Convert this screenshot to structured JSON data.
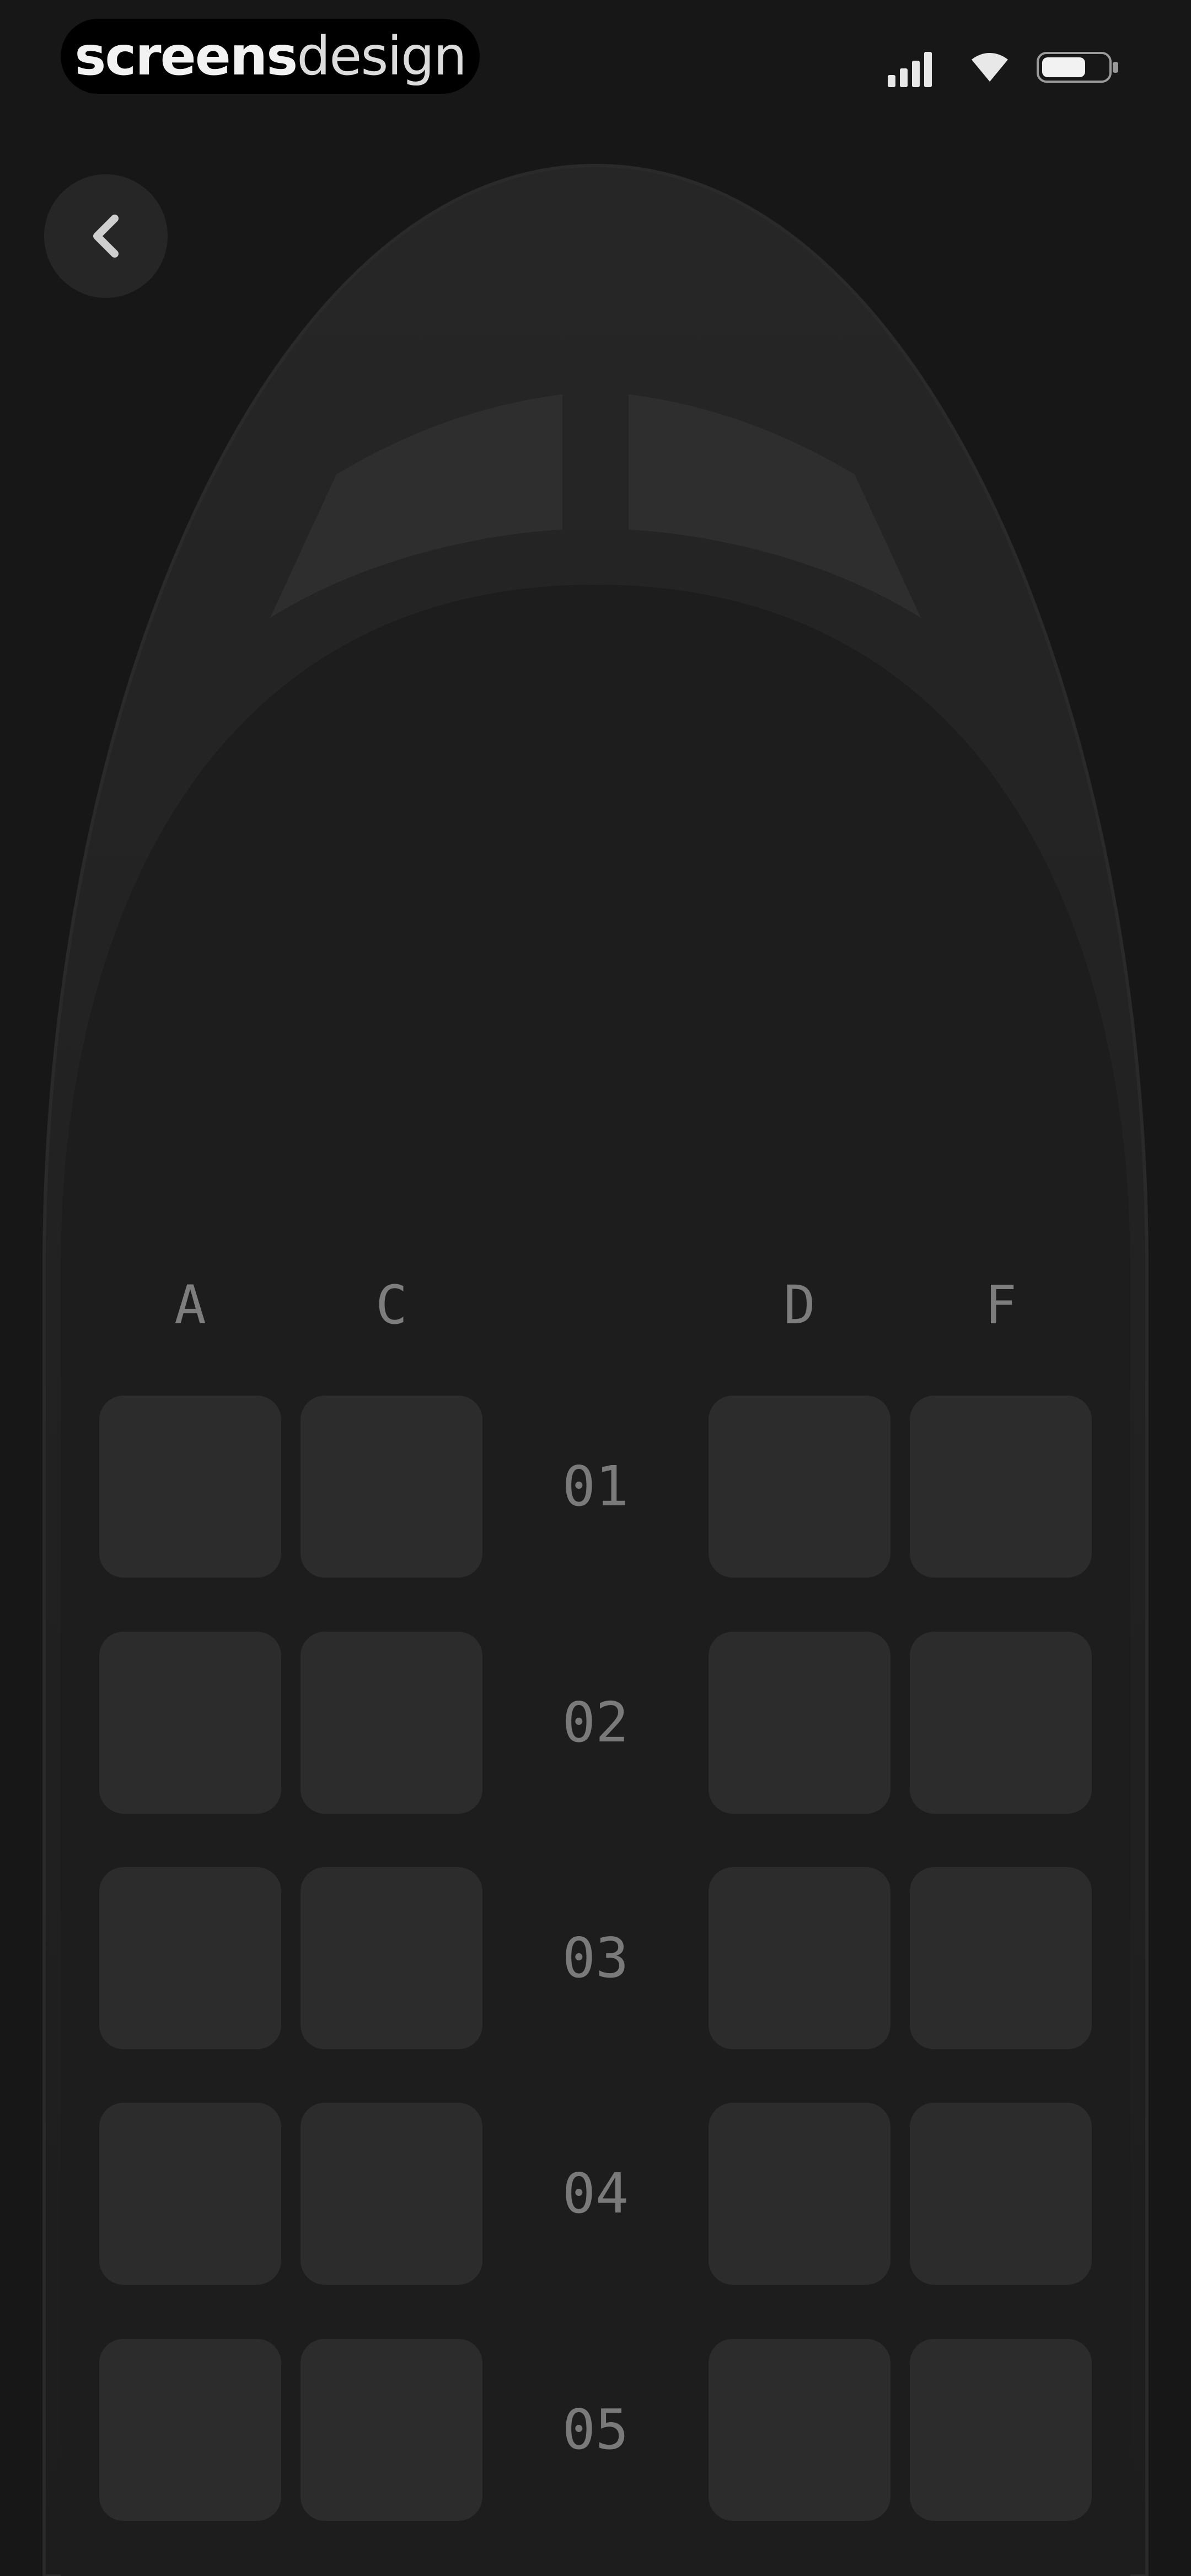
{
  "status_bar": {
    "brand_bold": "screens",
    "brand_light": "design",
    "icons": [
      "signal-icon",
      "wifi-icon",
      "battery-icon"
    ]
  },
  "navigation": {
    "back_icon": "chevron-left-icon"
  },
  "seat_map": {
    "columns": [
      "A",
      "C",
      "D",
      "F"
    ],
    "rows": [
      {
        "number": "01"
      },
      {
        "number": "02"
      },
      {
        "number": "03"
      },
      {
        "number": "04"
      },
      {
        "number": "05"
      }
    ]
  },
  "colors": {
    "background": "#171717",
    "fuselage": "#1e1e1e",
    "seat": "#2c2c2c",
    "label": "#7d7d7d"
  }
}
